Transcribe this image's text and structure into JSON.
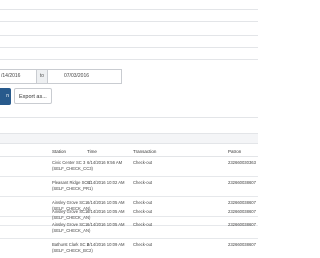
{
  "filters": {
    "date_from": "/14/2016",
    "date_separator": "to",
    "date_to": "07/03/2016"
  },
  "actions": {
    "primary_label": "n",
    "export_label": "Export as..."
  },
  "table": {
    "columns": [
      "Station",
      "Time",
      "Transaction",
      "Patron"
    ],
    "rows": [
      {
        "station_name": "Civic Center SC 3",
        "station_id": "(SELF_CHECK_CC3)",
        "time": "6/14/2016 9:56 AM",
        "transaction": "Check-out",
        "patron": "232660030363"
      },
      {
        "station_name": "Pleasant Ridge SC 1",
        "station_id": "(SELF_CHECK_PR1)",
        "time": "6/14/2016 10:02 AM",
        "transaction": "Check-out",
        "patron": "232660038607"
      },
      {
        "station_name": "Ainsley Grove SC1",
        "station_id": "(SELF_CHECK_AN)",
        "time": "6/14/2016 10:05 AM",
        "transaction": "Check-out",
        "patron": "232660038607"
      },
      {
        "station_name": "Ainsley Grove SC1",
        "station_id": "(SELF_CHECK_AN)",
        "time": "6/14/2016 10:05 AM",
        "transaction": "Check-out",
        "patron": "232660038607"
      },
      {
        "station_name": "Ainsley Grove SC1",
        "station_id": "(SELF_CHECK_AN)",
        "time": "6/14/2016 10:05 AM",
        "transaction": "Check-out",
        "patron": "232660038607"
      },
      {
        "station_name": "Bathurst Clark SC 2",
        "station_id": "(SELF_CHECK_BC2)",
        "time": "6/14/2016 10:09 AM",
        "transaction": "Check-out",
        "patron": "232660038607"
      }
    ]
  }
}
